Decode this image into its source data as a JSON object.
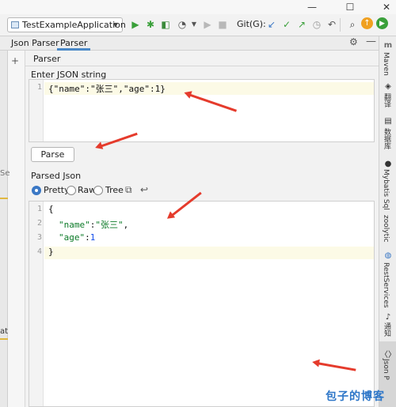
{
  "toolbar": {
    "run_config": "TestExampleApplication",
    "git_label": "Git(G):"
  },
  "tabs": [
    "Json Parser",
    "Parser"
  ],
  "subbar": {
    "add": "+",
    "title": "Parser"
  },
  "input_panel": {
    "label": "Enter JSON string",
    "line_numbers": [
      "1"
    ],
    "content": "{\"name\":\"张三\",\"age\":1}"
  },
  "parse_button": "Parse",
  "output_panel": {
    "label": "Parsed Json",
    "modes": [
      "Pretty",
      "Raw",
      "Tree"
    ],
    "selected_mode": "Pretty",
    "line_numbers": [
      "1",
      "2",
      "3",
      "4"
    ],
    "lines": {
      "l1": "{",
      "l2_key": "\"name\"",
      "l2_sep": ":",
      "l2_val": "\"张三\"",
      "l2_end": ",",
      "l3_key": "\"age\"",
      "l3_sep": ":",
      "l3_val": "1",
      "l4": "}"
    }
  },
  "right_tools": [
    "Maven",
    "翻译",
    "数据库",
    "Mybatis Sql",
    "zoolytic",
    "RestServices",
    "通知",
    "Json P"
  ],
  "left_edge_fragments": [
    "Se",
    "at"
  ],
  "watermark": "包子的博客",
  "colors": {
    "accent": "#4a88c7",
    "arrow": "#e53b2c",
    "json_key": "#0b7a27",
    "json_number": "#1750eb"
  }
}
